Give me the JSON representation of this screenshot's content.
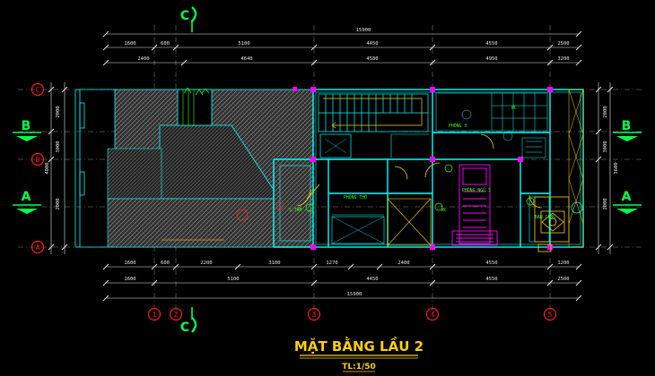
{
  "sheet": {
    "title": "MẶT BẰNG LẦU 2",
    "scale": "TL:1/50"
  },
  "grid_axes": {
    "numbers": [
      "1",
      "2",
      "3",
      "4",
      "5"
    ],
    "letters": [
      "A",
      "B",
      "C"
    ]
  },
  "section_marks": [
    "C",
    "C",
    "B",
    "B",
    "A",
    "A"
  ],
  "dimensions": {
    "overall_top": "15900",
    "overall_bottom": "15900",
    "top_row1": [
      "1600",
      "600",
      "5100",
      "4450",
      "4550",
      "2500"
    ],
    "top_row2": [
      "2400",
      "4640",
      "4580",
      "4950",
      "3200"
    ],
    "bottom_row1": [
      "1600",
      "600",
      "2200",
      "3100",
      "1270",
      "2400",
      "4550",
      "1200"
    ],
    "bottom_row2": [
      "1600",
      "5100",
      "4450",
      "4550",
      "2500"
    ],
    "left_side": [
      "2000",
      "3000",
      "2000",
      "4000"
    ],
    "right_side": [
      "2000",
      "3000",
      "2000",
      "3600"
    ]
  },
  "room_labels": [
    "PHÒNG 3",
    "PHÒNG THỜ",
    "PHÒNG NGỦ 3",
    "WC",
    "S.TẮM",
    "WC",
    "BAN CÔNG"
  ],
  "colors": {
    "background": "#000000",
    "wall": "#00ffff",
    "dimension": "#e8e8e8",
    "grid_marker": "#ff1a1a",
    "section_mark": "#00ff4c",
    "title": "#ffd000",
    "furniture": "#ff00ff",
    "hatch": "#8c8c8c",
    "accent_green": "#39ff14",
    "accent_yellow": "#ffd400"
  }
}
